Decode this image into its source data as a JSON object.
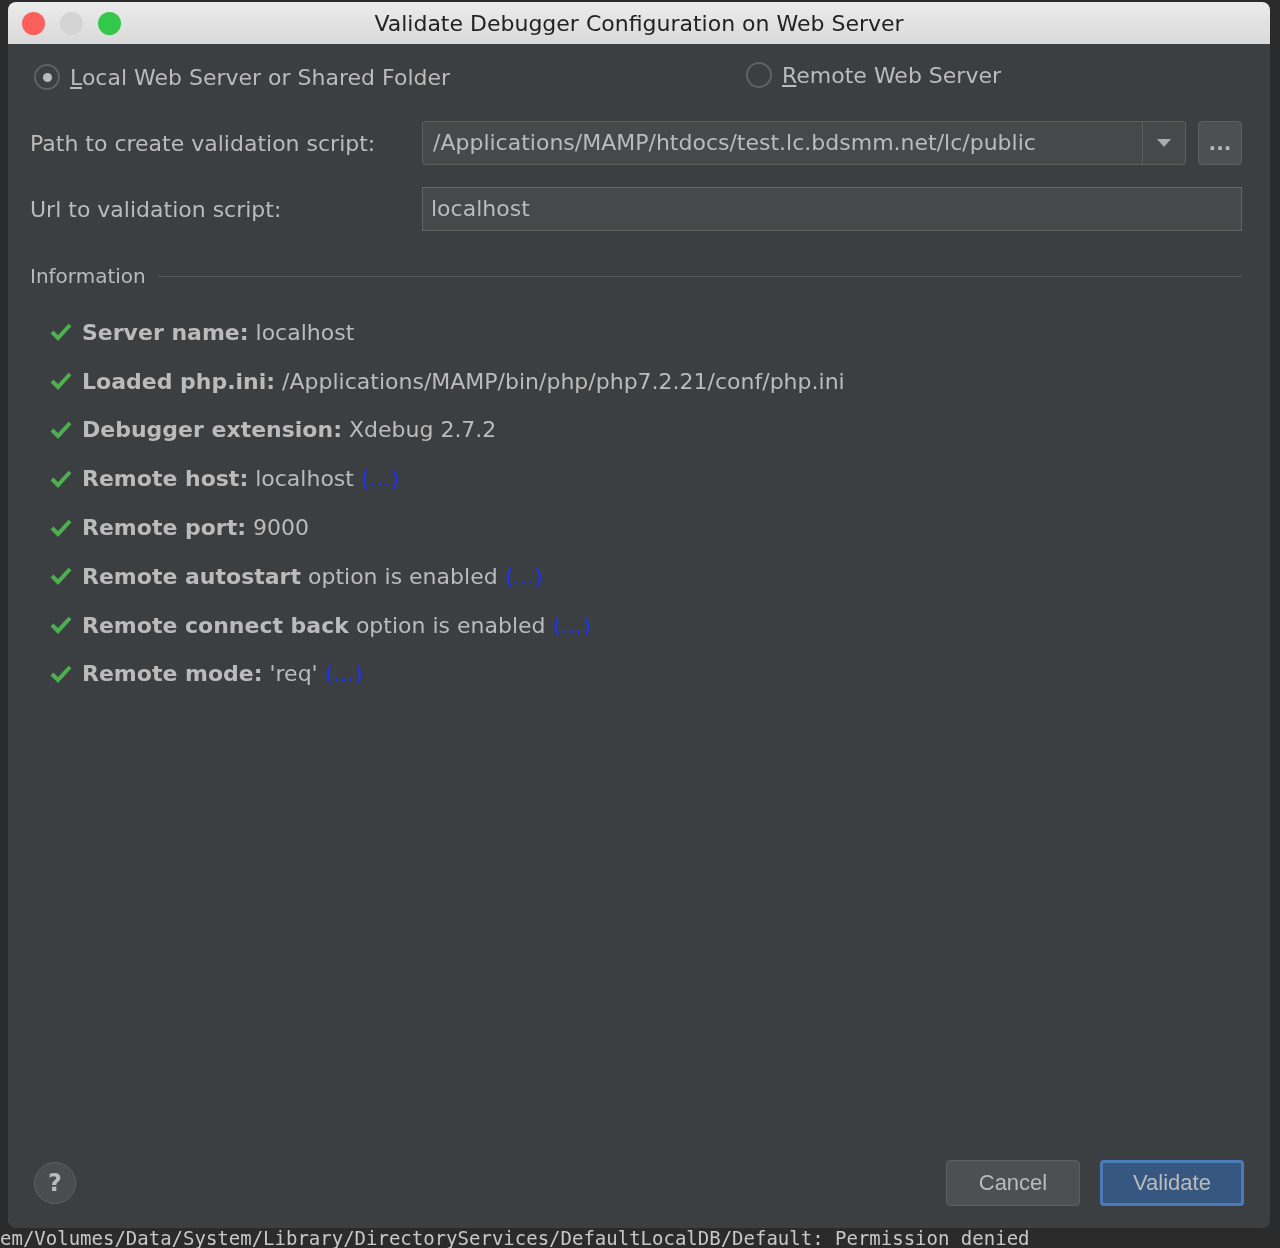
{
  "window": {
    "title": "Validate Debugger Configuration on Web Server"
  },
  "server_type": [
    {
      "label": "Local Web Server or Shared Folder",
      "selected": true
    },
    {
      "label": "Remote Web Server",
      "selected": false
    }
  ],
  "fields": [
    {
      "kind": "combo",
      "label": "Path to create validation script:",
      "value": "/Applications/MAMP/htdocs/test.lc.bdsmm.net/lc/public",
      "browse": "..."
    },
    {
      "kind": "text",
      "label": "Url to validation script:",
      "value": "localhost"
    }
  ],
  "information": {
    "title": "Information",
    "items": [
      {
        "passed": true,
        "text": "**Server name:** localhost"
      },
      {
        "passed": true,
        "text": "**Loaded php.ini:** /Applications/MAMP/bin/php/php7.2.21/conf/php.ini"
      },
      {
        "passed": true,
        "text": "**Debugger extension:** Xdebug 2.7.2"
      },
      {
        "passed": true,
        "text": "**Remote host:** localhost",
        "link": "(...)"
      },
      {
        "passed": true,
        "text": "**Remote port:** 9000"
      },
      {
        "passed": true,
        "text": "**Remote autostart** option is enabled",
        "link": "(...)"
      },
      {
        "passed": true,
        "text": "**Remote connect back** option is enabled",
        "link": "(...)"
      },
      {
        "passed": true,
        "text": "**Remote mode:** 'req'",
        "link": "(...)"
      }
    ]
  },
  "help": "?",
  "buttons": [
    {
      "label": "Cancel",
      "default": false
    },
    {
      "label": "Validate",
      "default": true
    }
  ],
  "console_line": "em/Volumes/Data/System/Library/DirectoryServices/DefaultLocalDB/Default: Permission denied"
}
